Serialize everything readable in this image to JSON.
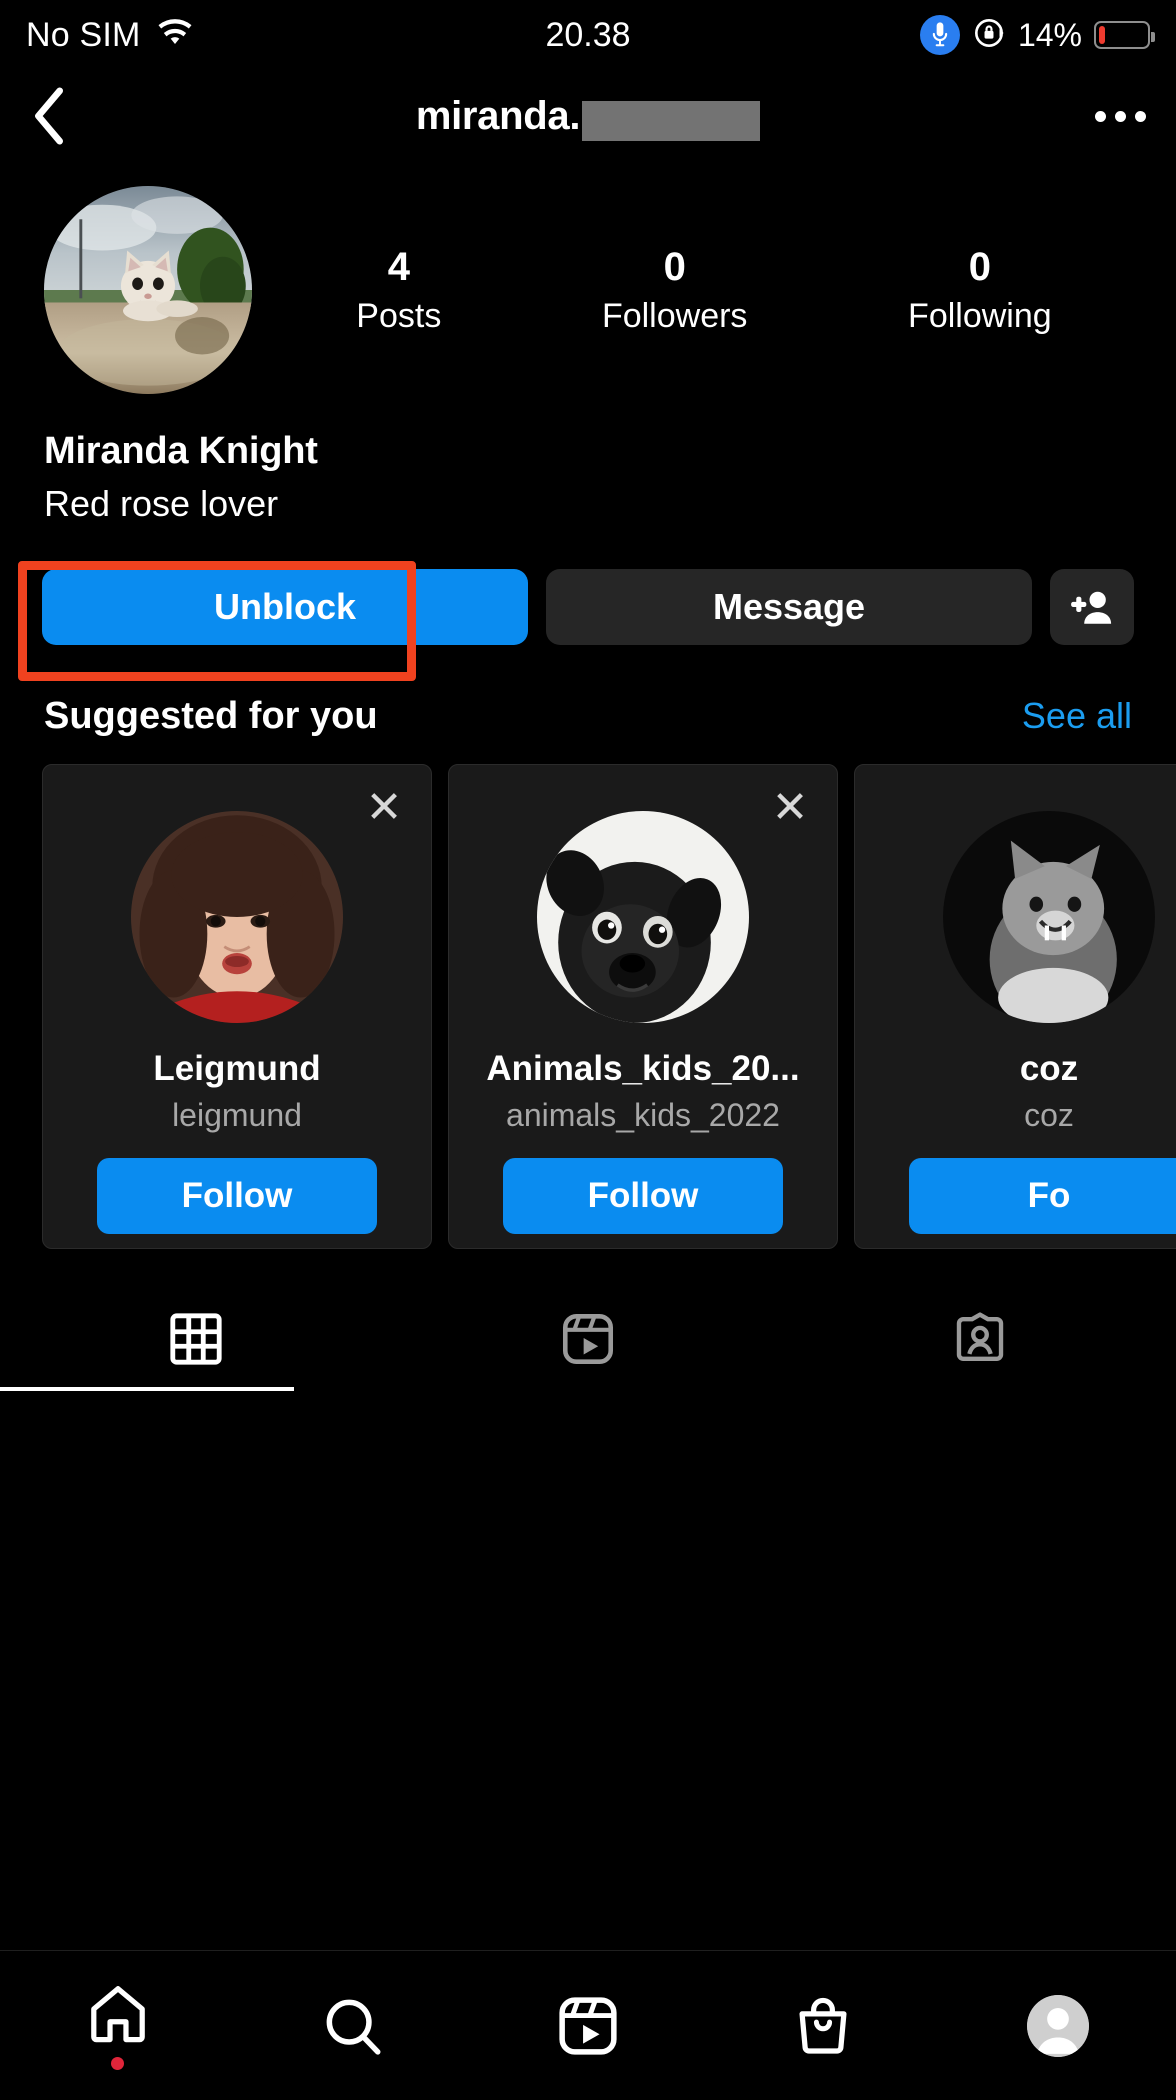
{
  "status_bar": {
    "carrier": "No SIM",
    "wifi_icon": "wifi-icon",
    "time": "20.38",
    "mic_icon": "microphone-icon",
    "rotation_lock_icon": "rotation-lock-icon",
    "battery_percent": "14%",
    "battery_level": 14,
    "battery_color": "#ee3b2f"
  },
  "nav_bar": {
    "back_icon": "back-chevron-icon",
    "username": "miranda.",
    "username_redacted": true,
    "more_icon": "more-options-icon"
  },
  "profile": {
    "avatar_alt": "cat-in-water-avatar",
    "stats": [
      {
        "value": "4",
        "label": "Posts"
      },
      {
        "value": "0",
        "label": "Followers"
      },
      {
        "value": "0",
        "label": "Following"
      }
    ],
    "display_name": "Miranda Knight",
    "bio": "Red rose lover"
  },
  "actions": {
    "primary_label": "Unblock",
    "primary_color": "#0a8cf0",
    "secondary_label": "Message",
    "secondary_color": "#262626",
    "add_person_icon": "add-person-icon",
    "highlight_color": "#f0421f",
    "highlight_target": "Unblock"
  },
  "suggested": {
    "title": "Suggested for you",
    "see_all_label": "See all",
    "see_all_color": "#1b9df0",
    "follow_label": "Follow",
    "close_icon": "close-icon",
    "cards": [
      {
        "name": "Leigmund",
        "handle": "leigmund",
        "avatar_alt": "woman-portrait-avatar",
        "follow_label": "Follow"
      },
      {
        "name": "Animals_kids_20...",
        "handle": "animals_kids_2022",
        "avatar_alt": "black-pug-avatar",
        "follow_label": "Follow"
      },
      {
        "name": "coz",
        "handle": "coz",
        "avatar_alt": "cat-bw-avatar",
        "follow_label": "Fo"
      }
    ]
  },
  "profile_tabs": [
    {
      "icon": "grid-icon",
      "active": true
    },
    {
      "icon": "reels-icon",
      "active": false
    },
    {
      "icon": "tagged-icon",
      "active": false
    }
  ],
  "bottom_nav": [
    {
      "icon": "home-icon",
      "active": true,
      "badge": true
    },
    {
      "icon": "search-icon",
      "active": false,
      "badge": false
    },
    {
      "icon": "reels-icon",
      "active": false,
      "badge": false
    },
    {
      "icon": "shop-icon",
      "active": false,
      "badge": false
    },
    {
      "icon": "profile-avatar-icon",
      "active": false,
      "badge": false
    }
  ]
}
